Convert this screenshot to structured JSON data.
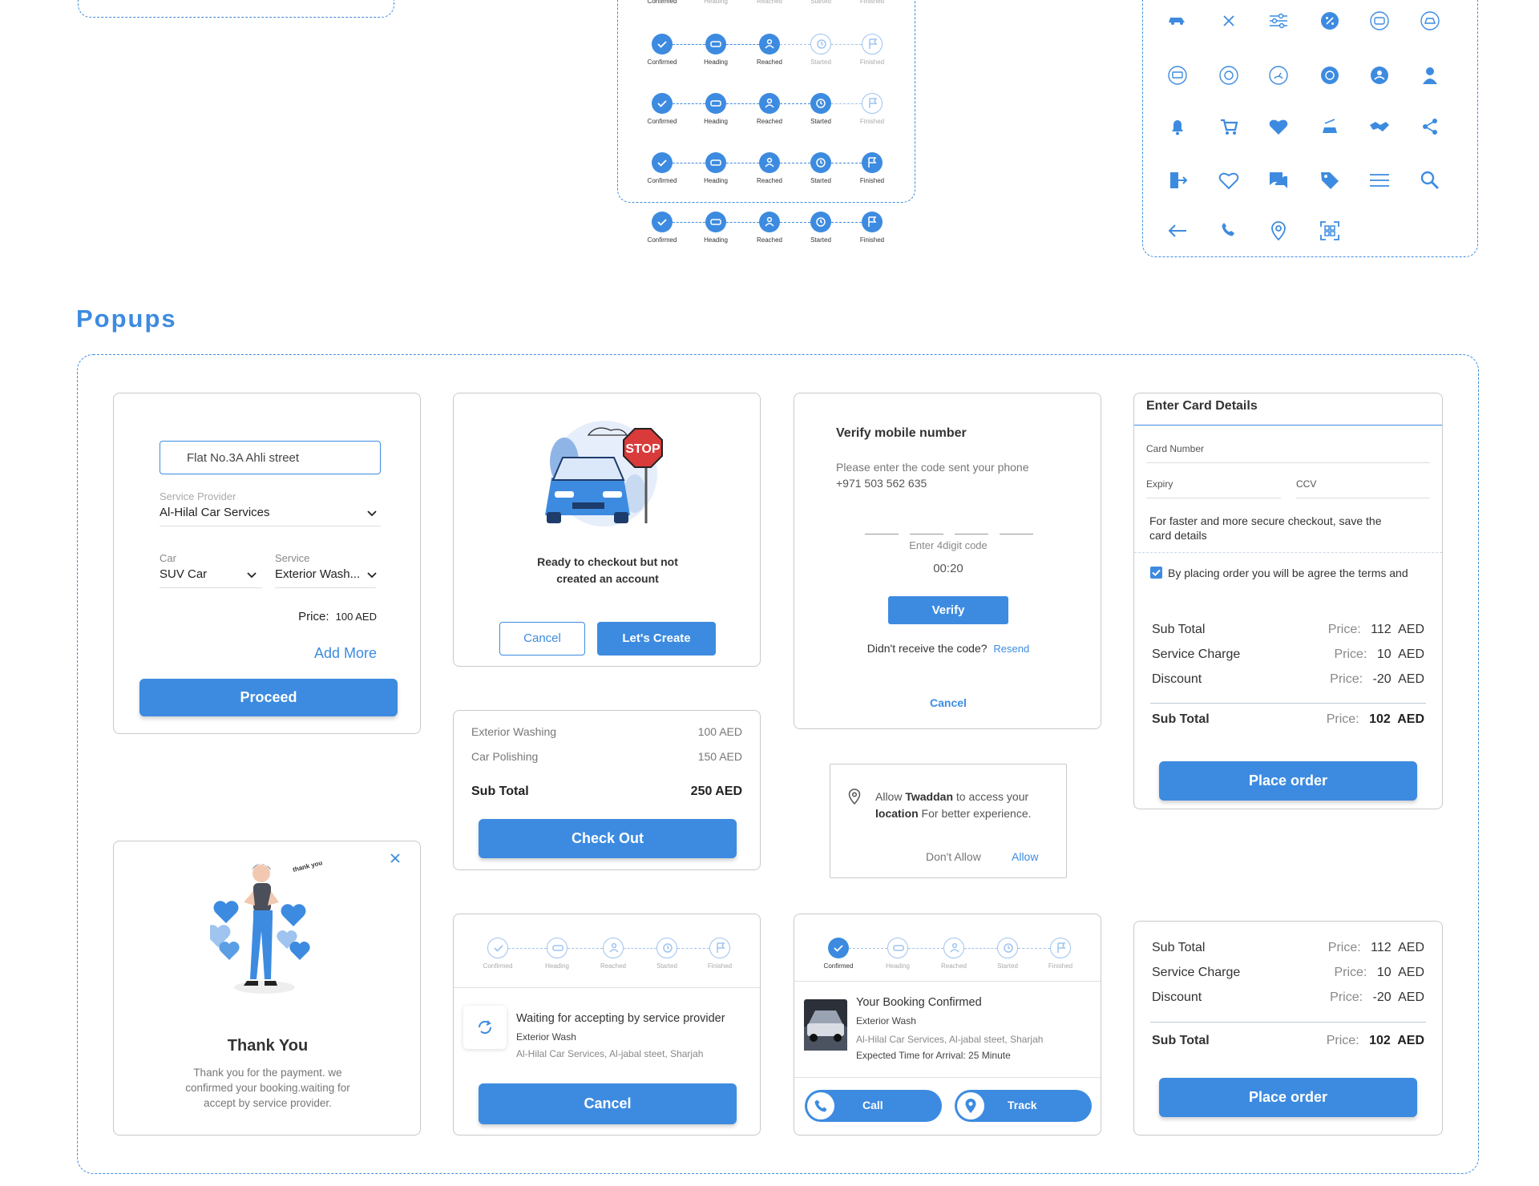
{
  "section_title": "Popups",
  "steps": {
    "labels": [
      "Confirmed",
      "Heading",
      "Reached",
      "Started",
      "Finished"
    ],
    "tracker_rows_active": [
      1,
      2,
      3,
      4,
      5
    ]
  },
  "icons": [
    "car-icon",
    "close-icon",
    "filter-icon",
    "discount-icon",
    "bus-icon",
    "vehicle-icon",
    "van-icon",
    "truck-icon",
    "speed-icon",
    "wash-icon",
    "user-circle-icon",
    "user-icon",
    "bell-icon",
    "cart-icon",
    "heart-filled-icon",
    "car-wash-icon",
    "handshake-icon",
    "share-icon",
    "logout-icon",
    "heart-outline-icon",
    "chat-icon",
    "tag-icon",
    "menu-icon",
    "search-icon",
    "back-arrow-icon",
    "phone-icon",
    "location-pin-icon",
    "qr-scan-icon"
  ],
  "booking_form": {
    "address_value": "Flat No.3A Ahli street",
    "provider_label": "Service Provider",
    "provider_value": "Al-Hilal Car Services",
    "car_label": "Car",
    "car_value": "SUV Car",
    "service_label": "Service",
    "service_value": "Exterior Wash...",
    "price_label": "Price:",
    "price_value": "100 AED",
    "add_more": "Add More",
    "proceed": "Proceed"
  },
  "checkout_popup": {
    "stop_text": "STOP",
    "message": "Ready to checkout but not created an account",
    "cancel": "Cancel",
    "create": "Let's Create"
  },
  "cart_summary": {
    "items": [
      {
        "name": "Exterior Washing",
        "price": "100 AED"
      },
      {
        "name": "Car Polishing",
        "price": "150 AED"
      }
    ],
    "subtotal_label": "Sub Total",
    "subtotal_value": "250 AED",
    "checkout": "Check Out"
  },
  "verify": {
    "title": "Verify mobile number",
    "desc_line1": "Please enter the code sent your phone",
    "desc_line2": "+971 503 562 635",
    "hint": "Enter 4digit code",
    "timer": "00:20",
    "verify_btn": "Verify",
    "no_code": "Didn't receive the code?",
    "resend": "Resend",
    "cancel": "Cancel"
  },
  "location": {
    "line1_a": "Allow ",
    "line1_b": "Twaddan",
    "line1_c": " to access your",
    "line2_a": "location",
    "line2_b": " For better experience.",
    "deny": "Don't Allow",
    "allow": "Allow"
  },
  "card_details": {
    "title": "Enter Card Details",
    "card_number": "Card Number",
    "expiry": "Expiry",
    "ccv": "CCV",
    "save_note": "For faster and more secure checkout, save the card details",
    "terms": "By placing order you will be agree the terms and",
    "rows": [
      {
        "label": "Sub Total",
        "price_label": "Price:",
        "amount": "112",
        "currency": "AED"
      },
      {
        "label": "Service Charge",
        "price_label": "Price:",
        "amount": "10",
        "currency": "AED"
      },
      {
        "label": "Discount",
        "price_label": "Price:",
        "amount": "-20",
        "currency": "AED"
      }
    ],
    "total_label": "Sub Total",
    "total_price_label": "Price:",
    "total_amount": "102",
    "total_currency": "AED",
    "place_order": "Place order"
  },
  "thank_you": {
    "bubble": "thank you!!!",
    "title": "Thank You",
    "message": "Thank you for the payment. we confirmed your booking.waiting for accept by service provider."
  },
  "waiting": {
    "title": "Waiting for accepting by service provider",
    "service": "Exterior Wash",
    "address": "Al-Hilal Car Services, Al-jabal steet, Sharjah",
    "cancel": "Cancel"
  },
  "confirmed": {
    "title": "Your Booking Confirmed",
    "service": "Exterior Wash",
    "address": "Al-Hilal Car Services, Al-jabal steet, Sharjah",
    "eta": "Expected Time for Arrival: 25 Minute",
    "call": "Call",
    "track": "Track"
  },
  "summary2": {
    "rows": [
      {
        "label": "Sub Total",
        "price_label": "Price:",
        "amount": "112",
        "currency": "AED"
      },
      {
        "label": "Service Charge",
        "price_label": "Price:",
        "amount": "10",
        "currency": "AED"
      },
      {
        "label": "Discount",
        "price_label": "Price:",
        "amount": "-20",
        "currency": "AED"
      }
    ],
    "total_label": "Sub Total",
    "total_price_label": "Price:",
    "total_amount": "102",
    "total_currency": "AED",
    "place_order": "Place order"
  },
  "colors": {
    "accent": "#3d8be0",
    "border": "#c9c9c9",
    "muted": "#8a8a8a"
  }
}
